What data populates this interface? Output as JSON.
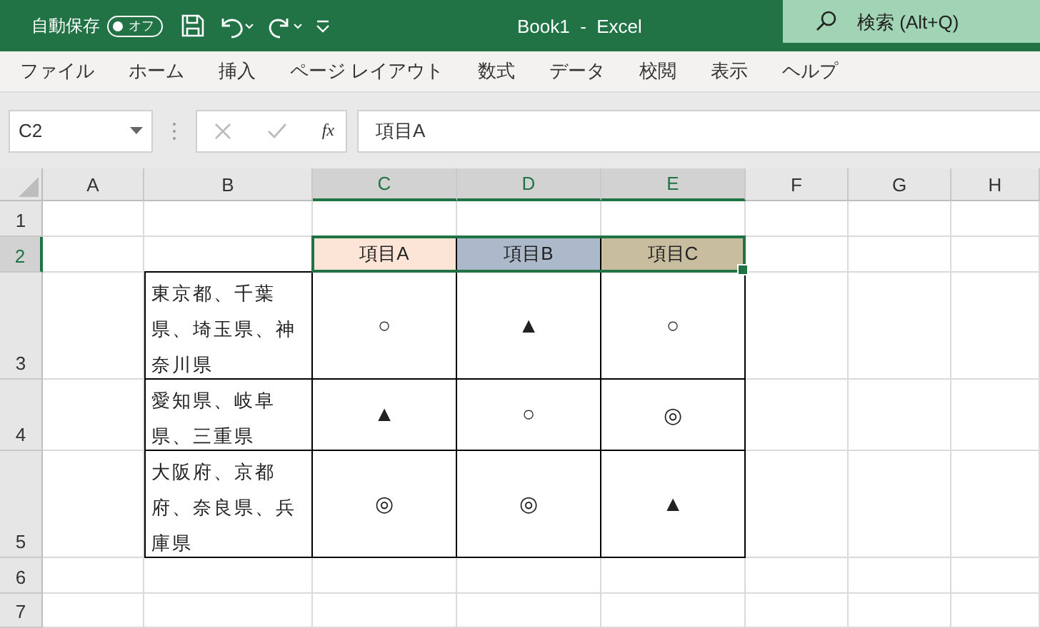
{
  "title_bar": {
    "autosave_label": "自動保存",
    "autosave_toggle": {
      "label": "オフ",
      "on": false
    },
    "title": "Book1  -  Excel",
    "search": {
      "placeholder": "検索 (Alt+Q)"
    }
  },
  "menu": [
    "ファイル",
    "ホーム",
    "挿入",
    "ページ レイアウト",
    "数式",
    "データ",
    "校閲",
    "表示",
    "ヘルプ"
  ],
  "formula_bar": {
    "name_box": "C2",
    "function_label": "fx",
    "value": "項目A"
  },
  "sheet": {
    "columns": [
      {
        "label": "A",
        "selected": false
      },
      {
        "label": "B",
        "selected": false
      },
      {
        "label": "C",
        "selected": true
      },
      {
        "label": "D",
        "selected": true
      },
      {
        "label": "E",
        "selected": true
      },
      {
        "label": "F",
        "selected": false
      },
      {
        "label": "G",
        "selected": false
      },
      {
        "label": "H",
        "selected": false
      }
    ],
    "rows": [
      {
        "label": "1",
        "selected": false
      },
      {
        "label": "2",
        "selected": true
      },
      {
        "label": "3",
        "selected": false
      },
      {
        "label": "4",
        "selected": false
      },
      {
        "label": "5",
        "selected": false
      },
      {
        "label": "6",
        "selected": false
      },
      {
        "label": "7",
        "selected": false
      }
    ],
    "table": {
      "headers": [
        {
          "text": "項目A",
          "color": "#fce4d6"
        },
        {
          "text": "項目B",
          "color": "#acb9ca"
        },
        {
          "text": "項目C",
          "color": "#c9bd9f"
        }
      ],
      "rows": [
        {
          "label": "東京都、千葉県、埼玉県、神奈川県",
          "marks": [
            "○",
            "▲",
            "○"
          ]
        },
        {
          "label": "愛知県、岐阜県、三重県",
          "marks": [
            "▲",
            "○",
            "◎"
          ]
        },
        {
          "label": "大阪府、京都府、奈良県、兵庫県",
          "marks": [
            "◎",
            "◎",
            "▲"
          ]
        }
      ]
    }
  }
}
